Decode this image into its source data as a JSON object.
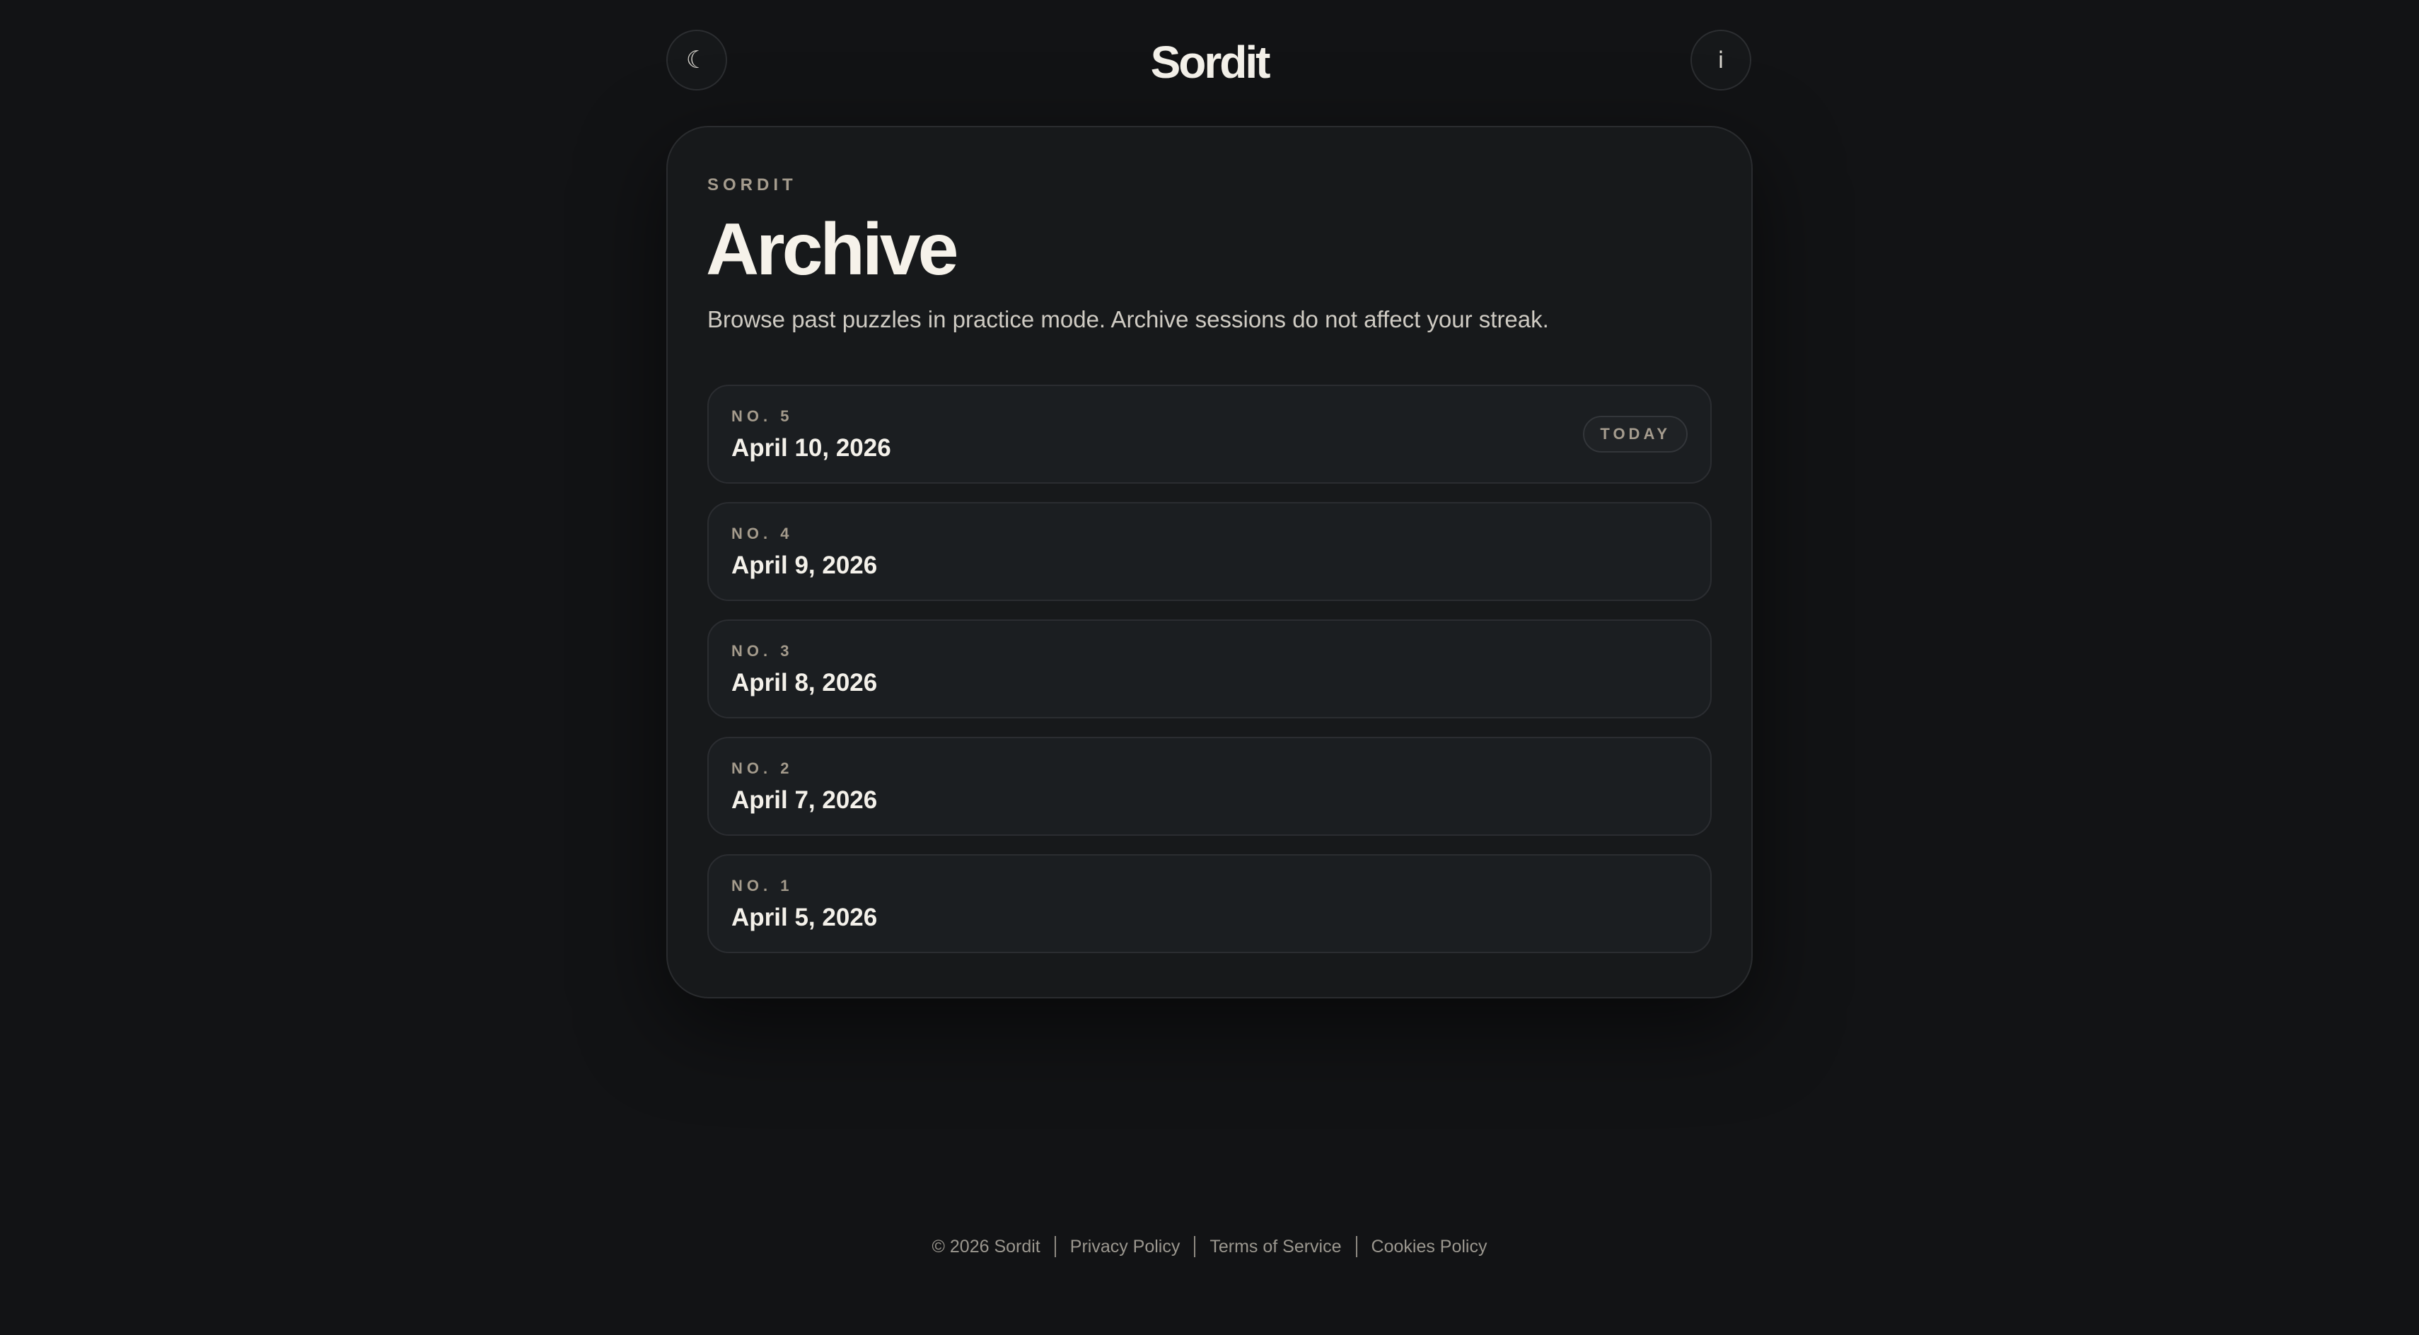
{
  "header": {
    "theme_icon": "☾",
    "brand": "Sordit",
    "info_icon": "i"
  },
  "archive": {
    "eyebrow": "SORDIT",
    "title": "Archive",
    "subtitle": "Browse past puzzles in practice mode. Archive sessions do not affect your streak.",
    "items": [
      {
        "number": "NO. 5",
        "date": "April 10, 2026",
        "badge": "TODAY"
      },
      {
        "number": "NO. 4",
        "date": "April 9, 2026"
      },
      {
        "number": "NO. 3",
        "date": "April 8, 2026"
      },
      {
        "number": "NO. 2",
        "date": "April 7, 2026"
      },
      {
        "number": "NO. 1",
        "date": "April 5, 2026"
      }
    ]
  },
  "footer": {
    "copyright": "© 2026 Sordit",
    "privacy": "Privacy Policy",
    "terms": "Terms of Service",
    "cookies": "Cookies Policy"
  }
}
